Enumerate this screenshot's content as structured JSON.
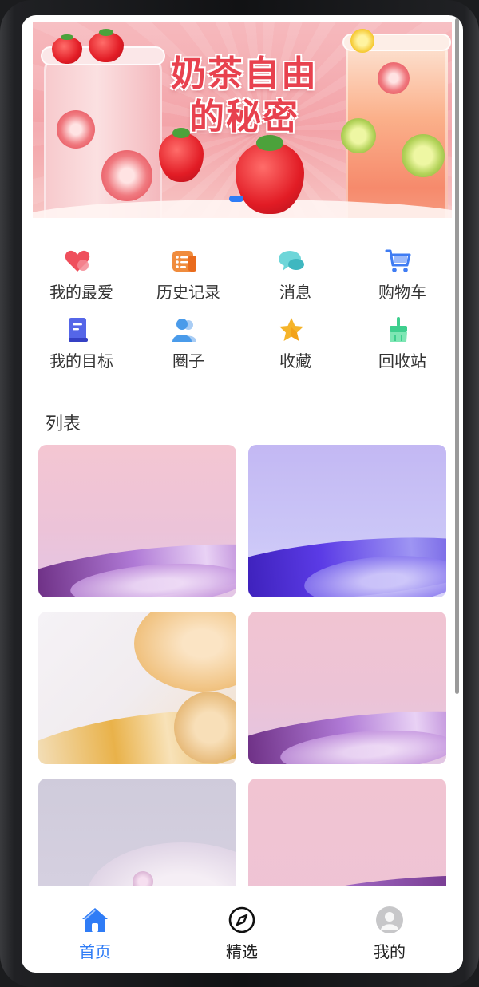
{
  "banner": {
    "title_line1": "奶茶自由",
    "title_line2": "的秘密",
    "active_dot": 1
  },
  "menu": {
    "items": [
      {
        "label": "我的最爱",
        "icon": "heart-icon",
        "color": "#ef4f5c"
      },
      {
        "label": "历史记录",
        "icon": "history-icon",
        "color": "#f08c3d"
      },
      {
        "label": "消息",
        "icon": "message-icon",
        "color": "#5fcfd4"
      },
      {
        "label": "购物车",
        "icon": "cart-icon",
        "color": "#3f7cf3"
      },
      {
        "label": "我的目标",
        "icon": "target-book-icon",
        "color": "#5566e8"
      },
      {
        "label": "圈子",
        "icon": "group-icon",
        "color": "#4a9bea"
      },
      {
        "label": "收藏",
        "icon": "star-icon",
        "color": "#f5b42a"
      },
      {
        "label": "回收站",
        "icon": "broom-icon",
        "color": "#3ecf8e"
      }
    ]
  },
  "list": {
    "title": "列表"
  },
  "tabbar": {
    "items": [
      {
        "label": "首页",
        "icon": "home-icon",
        "active": true
      },
      {
        "label": "精选",
        "icon": "compass-icon",
        "active": false
      },
      {
        "label": "我的",
        "icon": "avatar-icon",
        "active": false
      }
    ],
    "active_color": "#2f7cf6"
  }
}
